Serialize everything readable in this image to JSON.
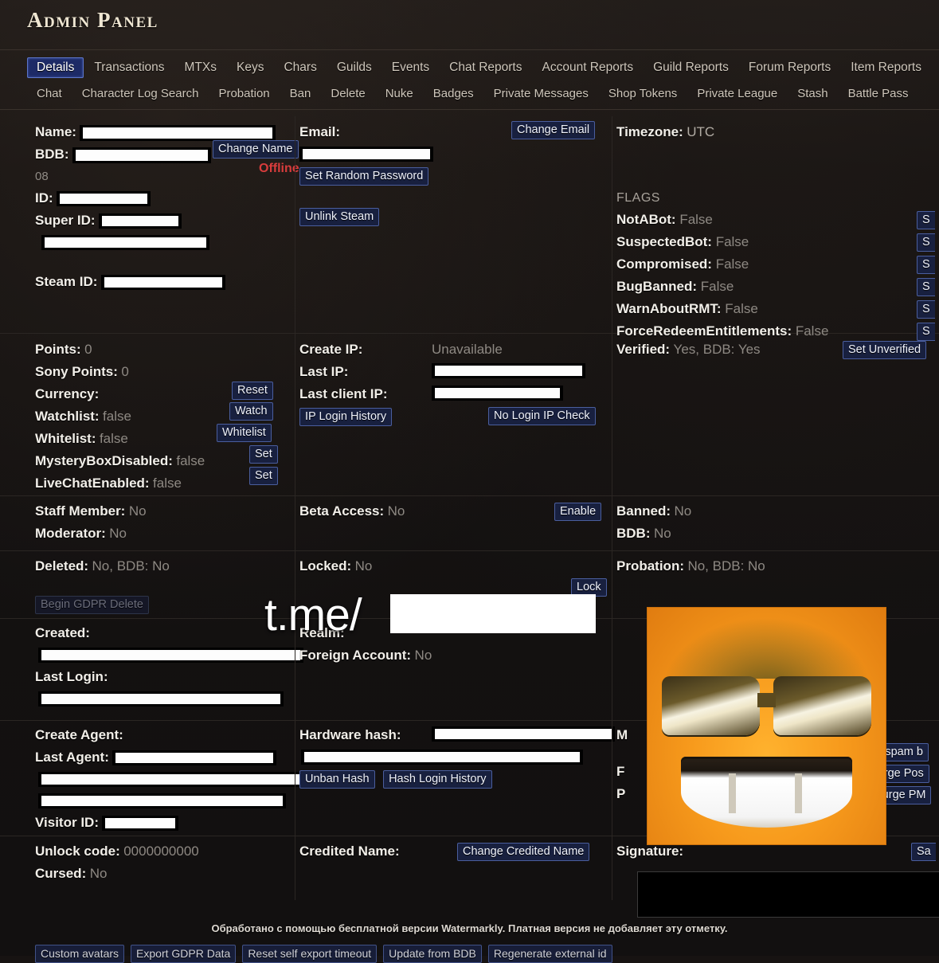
{
  "app": {
    "title": "Admin Panel",
    "redacted_placeholder": ""
  },
  "tabs_primary": [
    {
      "label": "Details",
      "active": true
    },
    {
      "label": "Transactions",
      "active": false
    },
    {
      "label": "MTXs",
      "active": false
    },
    {
      "label": "Keys",
      "active": false
    },
    {
      "label": "Chars",
      "active": false
    },
    {
      "label": "Guilds",
      "active": false
    },
    {
      "label": "Events",
      "active": false
    },
    {
      "label": "Chat Reports",
      "active": false
    },
    {
      "label": "Account Reports",
      "active": false
    },
    {
      "label": "Guild Reports",
      "active": false
    },
    {
      "label": "Forum Reports",
      "active": false
    },
    {
      "label": "Item Reports",
      "active": false
    }
  ],
  "tabs_secondary": [
    {
      "label": "Chat"
    },
    {
      "label": "Character Log Search"
    },
    {
      "label": "Probation"
    },
    {
      "label": "Ban"
    },
    {
      "label": "Delete"
    },
    {
      "label": "Nuke"
    },
    {
      "label": "Badges"
    },
    {
      "label": "Private Messages"
    },
    {
      "label": "Shop Tokens"
    },
    {
      "label": "Private League"
    },
    {
      "label": "Stash"
    },
    {
      "label": "Battle Pass"
    }
  ],
  "identity": {
    "name_label": "Name:",
    "bdb_label": "BDB:",
    "bdb_suffix": "08",
    "id_label": "ID:",
    "super_id_label": "Super ID:",
    "steam_id_label": "Steam ID:",
    "change_name_button": "Change Name",
    "status": "Offline"
  },
  "account": {
    "email_label": "Email:",
    "change_email_button": "Change Email",
    "set_random_password_button": "Set Random Password",
    "unlink_steam_button": "Unlink Steam",
    "timezone_label": "Timezone:",
    "timezone_value": "UTC"
  },
  "flags": {
    "heading": "FLAGS",
    "items": [
      {
        "label": "NotABot:",
        "value": "False",
        "button": "S"
      },
      {
        "label": "SuspectedBot:",
        "value": "False",
        "button": "S"
      },
      {
        "label": "Compromised:",
        "value": "False",
        "button": "S"
      },
      {
        "label": "BugBanned:",
        "value": "False",
        "button": "S"
      },
      {
        "label": "WarnAboutRMT:",
        "value": "False",
        "button": "S"
      },
      {
        "label": "ForceRedeemEntitlements:",
        "value": "False",
        "button": "S"
      }
    ]
  },
  "verified": {
    "label": "Verified:",
    "value": "Yes, BDB: Yes",
    "button": "Set Unverified"
  },
  "points": {
    "points_label": "Points:",
    "points_value": "0",
    "sony_points_label": "Sony Points:",
    "sony_points_value": "0",
    "currency_label": "Currency:",
    "currency_button": "Reset",
    "watchlist_label": "Watchlist:",
    "watchlist_value": "false",
    "watchlist_button": "Watch",
    "whitelist_label": "Whitelist:",
    "whitelist_value": "false",
    "whitelist_button": "Whitelist",
    "mysterybox_label": "MysteryBoxDisabled:",
    "mysterybox_value": "false",
    "mysterybox_button": "Set",
    "livechat_label": "LiveChatEnabled:",
    "livechat_value": "false",
    "livechat_button": "Set"
  },
  "ip": {
    "create_ip_label": "Create IP:",
    "create_ip_value": "Unavailable",
    "last_ip_label": "Last IP:",
    "last_client_ip_label": "Last client IP:",
    "ip_login_history_button": "IP Login History",
    "no_login_ip_check_button": "No Login IP Check"
  },
  "staff": {
    "staff_member_label": "Staff Member:",
    "staff_member_value": "No",
    "moderator_label": "Moderator:",
    "moderator_value": "No",
    "deleted_label": "Deleted:",
    "deleted_value": "No, BDB: No",
    "gdpr_delete_button": "Begin GDPR Delete"
  },
  "access": {
    "beta_access_label": "Beta Access:",
    "beta_access_value": "No",
    "enable_button": "Enable",
    "locked_label": "Locked:",
    "locked_value": "No",
    "lock_button": "Lock"
  },
  "ban": {
    "banned_label": "Banned:",
    "banned_value": "No",
    "bdb_label": "BDB:",
    "bdb_value": "No",
    "probation_label": "Probation:",
    "probation_value": "No, BDB: No"
  },
  "dates": {
    "created_label": "Created:",
    "last_login_label": "Last Login:",
    "realm_label": "Realm:",
    "foreign_account_label": "Foreign Account:",
    "foreign_account_value": "No"
  },
  "agents": {
    "create_agent_label": "Create Agent:",
    "last_agent_label": "Last Agent:",
    "visitor_id_label": "Visitor ID:",
    "hardware_hash_label": "Hardware hash:",
    "unban_hash_button": "Unban Hash",
    "hash_login_history_button": "Hash Login History"
  },
  "moderation": {
    "row1_label": "M",
    "row2_label": "F",
    "row3_label": "P",
    "mark_spam_button": "as spam b",
    "purge_posts_button": "Purge Pos",
    "purge_pms_button": "Purge PM"
  },
  "footer": {
    "unlock_code_label": "Unlock code:",
    "unlock_code_value": "0000000000",
    "cursed_label": "Cursed:",
    "cursed_value": "No",
    "credited_name_label": "Credited Name:",
    "change_credited_name_button": "Change Credited Name",
    "signature_label": "Signature:",
    "signature_save_button": "Sa",
    "signature_value": ""
  },
  "bottom_buttons": [
    {
      "label": "Custom avatars"
    },
    {
      "label": "Export GDPR Data"
    },
    {
      "label": "Reset self export timeout"
    },
    {
      "label": "Update from BDB"
    },
    {
      "label": "Regenerate external id"
    }
  ],
  "overlay": {
    "telegram_prefix": "t.me/",
    "watermark_text": "Обработано с помощью бесплатной версии Watermarkly. Платная версия не добавляет эту отметку."
  }
}
